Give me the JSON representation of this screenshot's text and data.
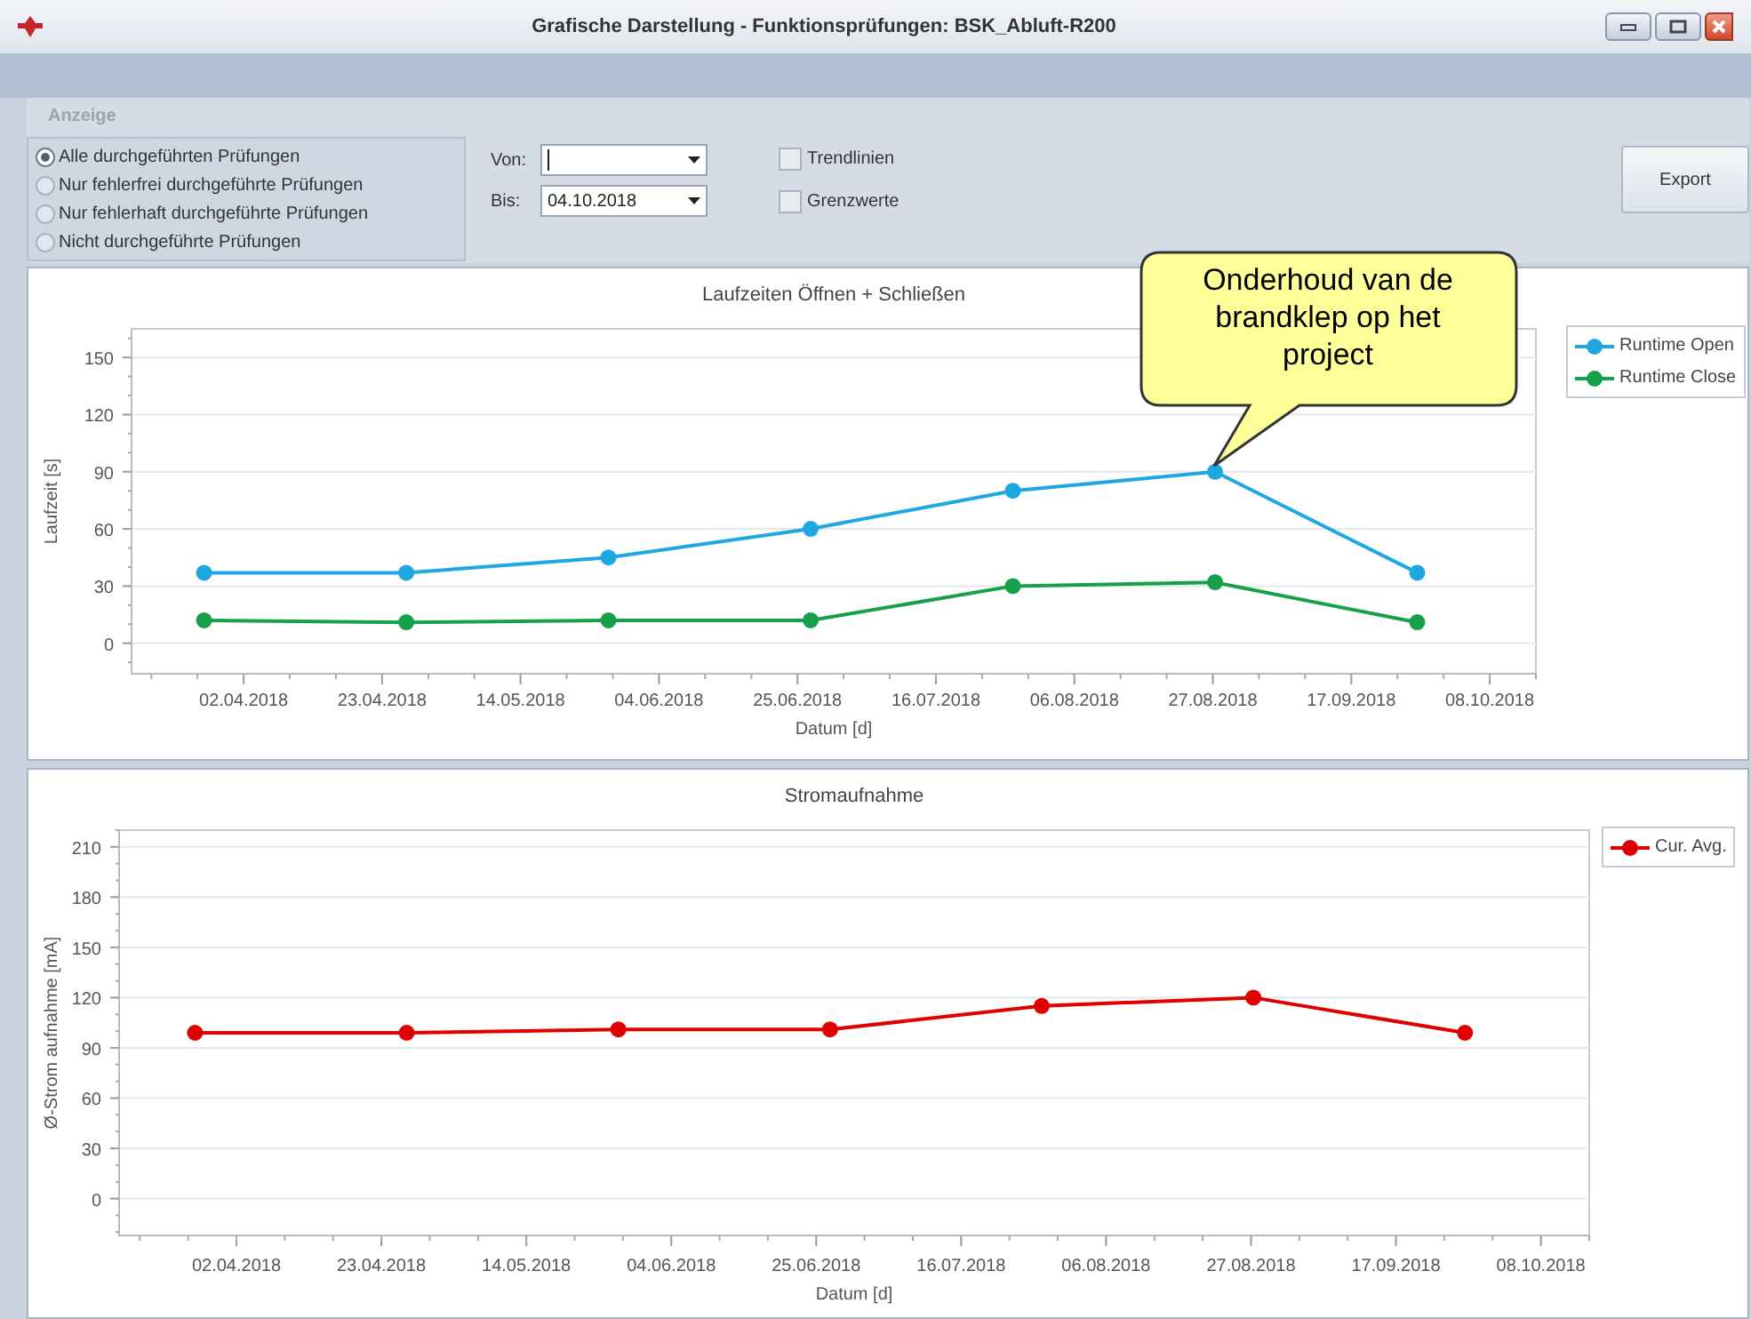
{
  "window": {
    "title": "Grafische Darstellung - Funktionsprüfungen: BSK_Abluft-R200"
  },
  "section_label": "Anzeige",
  "filter_options": [
    {
      "label": "Alle durchgeführten Prüfungen",
      "selected": true
    },
    {
      "label": "Nur fehlerfrei durchgeführte Prüfungen",
      "selected": false
    },
    {
      "label": "Nur fehlerhaft durchgeführte Prüfungen",
      "selected": false
    },
    {
      "label": "Nicht durchgeführte Prüfungen",
      "selected": false
    }
  ],
  "date_from": {
    "label": "Von:"
  },
  "date_to": {
    "label": "Bis:",
    "value": "04.10.2018"
  },
  "checkboxes": [
    {
      "label": "Trendlinien",
      "checked": false
    },
    {
      "label": "Grenzwerte",
      "checked": false
    }
  ],
  "export_button": "Export",
  "charts": [
    {
      "x_axis_labels": [
        "02.04.2018",
        "23.04.2018",
        "14.05.2018",
        "04.06.2018",
        "25.06.2018",
        "16.07.2018",
        "06.08.2018",
        "27.08.2018",
        "17.09.2018",
        "08.10.2018"
      ],
      "chart_data": {
        "type": "line",
        "title": "Laufzeiten Öffnen + Schließen",
        "xlabel": "Datum [d]",
        "ylabel": "Laufzeit [s]",
        "categories": [
          null,
          null,
          null,
          null,
          null,
          null,
          null
        ],
        "series": [
          {
            "name": "Runtime Open",
            "color": "#1ea7e0",
            "marker": "circle",
            "values": [
              37,
              37,
              45,
              60,
              80,
              90,
              37
            ]
          },
          {
            "name": "Runtime Close",
            "color": "#17a04a",
            "marker": "circle",
            "values": [
              12,
              11,
              12,
              12,
              30,
              32,
              11
            ]
          }
        ],
        "grid": true,
        "ylim": [
          -16,
          165
        ],
        "yticks": [
          0,
          30,
          60,
          90,
          120,
          150
        ]
      }
    },
    {
      "x_axis_labels": [
        "02.04.2018",
        "23.04.2018",
        "14.05.2018",
        "04.06.2018",
        "25.06.2018",
        "16.07.2018",
        "06.08.2018",
        "27.08.2018",
        "17.09.2018",
        "08.10.2018"
      ],
      "chart_data": {
        "type": "line",
        "title": "Stromaufnahme",
        "xlabel": "Datum [d]",
        "ylabel": "Ø-Strom aufnahme [mA]",
        "categories": [
          null,
          null,
          null,
          null,
          null,
          null,
          null
        ],
        "series": [
          {
            "name": "Cur. Avg.",
            "color": "#e00000",
            "marker": "circle",
            "values": [
              99,
              99,
              101,
              101,
              115,
              120,
              99
            ]
          }
        ],
        "grid": true,
        "ylim": [
          -22,
          220
        ],
        "yticks": [
          0,
          30,
          60,
          90,
          120,
          150,
          180,
          210
        ]
      }
    }
  ],
  "callout": {
    "text": "Onderhoud van de brandklep op het project"
  }
}
